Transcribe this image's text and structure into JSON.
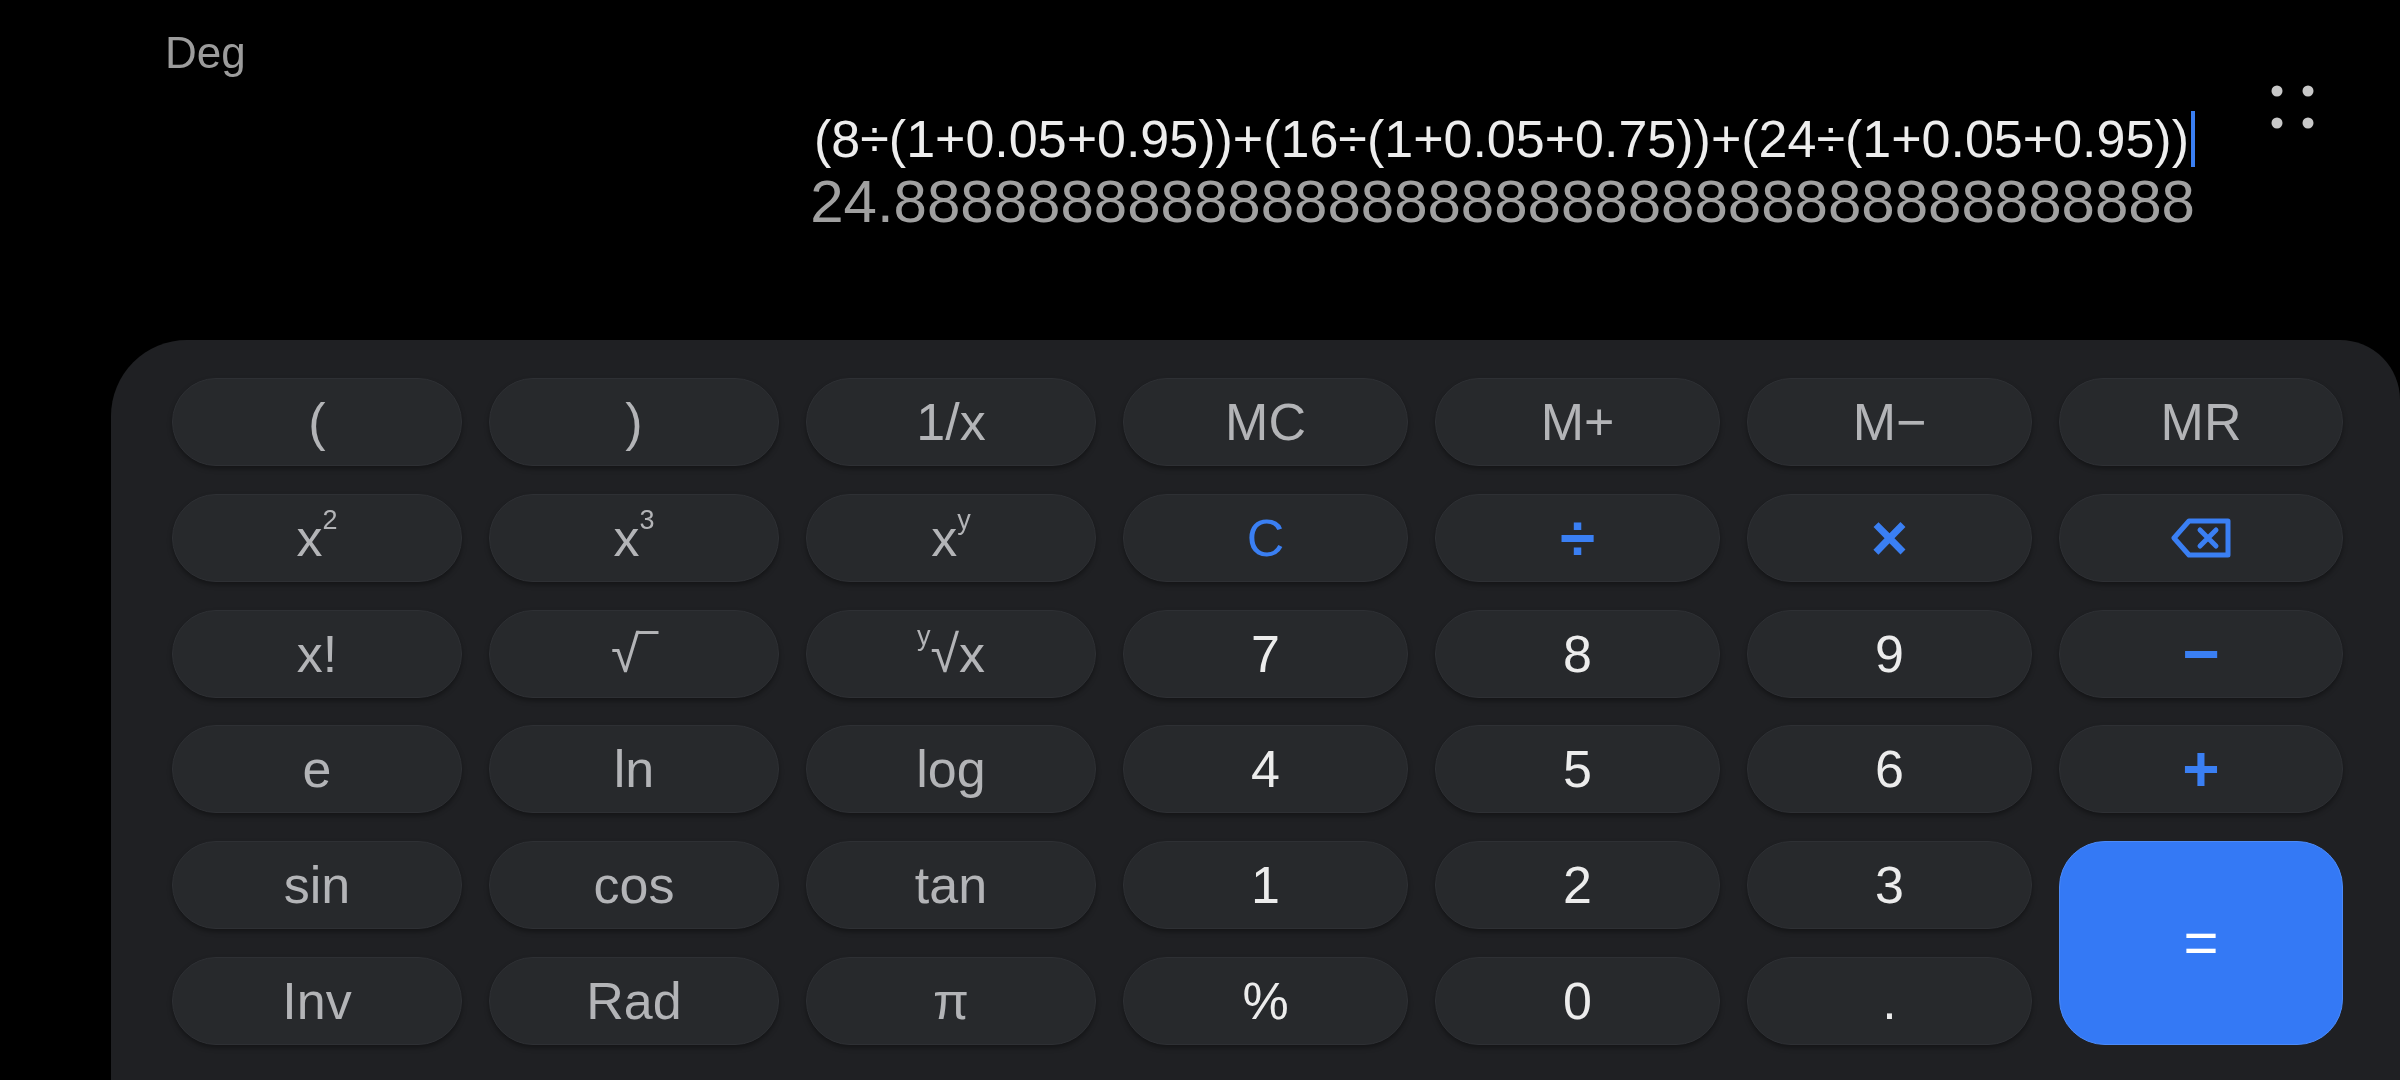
{
  "display": {
    "angle_unit": "Deg",
    "expression": "(8÷(1+0.05+0.95))+(16÷(1+0.05+0.75))+(24÷(1+0.05+0.95))",
    "cursor": true,
    "result": "24.888888888888888888888888888888888888888"
  },
  "keypad": {
    "keys": [
      {
        "label": "(",
        "kind": "function"
      },
      {
        "label": ")",
        "kind": "function"
      },
      {
        "label": "1/x",
        "kind": "function"
      },
      {
        "label": "MC",
        "kind": "function"
      },
      {
        "label": "M+",
        "kind": "function"
      },
      {
        "label": "M−",
        "kind": "function"
      },
      {
        "label": "MR",
        "kind": "function"
      },
      {
        "label": "x$^{2}$",
        "kind": "function"
      },
      {
        "label": "x$^{3}$",
        "kind": "function"
      },
      {
        "label": "x$^{y}$",
        "kind": "function"
      },
      {
        "label": "C",
        "kind": "clear"
      },
      {
        "label": "÷",
        "kind": "operator"
      },
      {
        "label": "×",
        "kind": "operator"
      },
      {
        "kind": "backspace"
      },
      {
        "label": "x!",
        "kind": "function"
      },
      {
        "label": "√‾",
        "kind": "function"
      },
      {
        "label": "$^{y}$√x",
        "kind": "function"
      },
      {
        "label": "7",
        "kind": "digit"
      },
      {
        "label": "8",
        "kind": "digit"
      },
      {
        "label": "9",
        "kind": "digit"
      },
      {
        "label": "−",
        "kind": "operator"
      },
      {
        "label": "e",
        "kind": "function"
      },
      {
        "label": "ln",
        "kind": "function"
      },
      {
        "label": "log",
        "kind": "function"
      },
      {
        "label": "4",
        "kind": "digit"
      },
      {
        "label": "5",
        "kind": "digit"
      },
      {
        "label": "6",
        "kind": "digit"
      },
      {
        "label": "+",
        "kind": "operator"
      },
      {
        "label": "sin",
        "kind": "function"
      },
      {
        "label": "cos",
        "kind": "function"
      },
      {
        "label": "tan",
        "kind": "function"
      },
      {
        "label": "1",
        "kind": "digit"
      },
      {
        "label": "2",
        "kind": "digit"
      },
      {
        "label": "3",
        "kind": "digit"
      },
      {
        "label": "=",
        "kind": "equals"
      },
      {
        "label": "Inv",
        "kind": "function"
      },
      {
        "label": "Rad",
        "kind": "function"
      },
      {
        "label": "π",
        "kind": "function"
      },
      {
        "label": "%",
        "kind": "digit"
      },
      {
        "label": "0",
        "kind": "digit"
      },
      {
        "label": ".",
        "kind": "digit"
      }
    ]
  }
}
